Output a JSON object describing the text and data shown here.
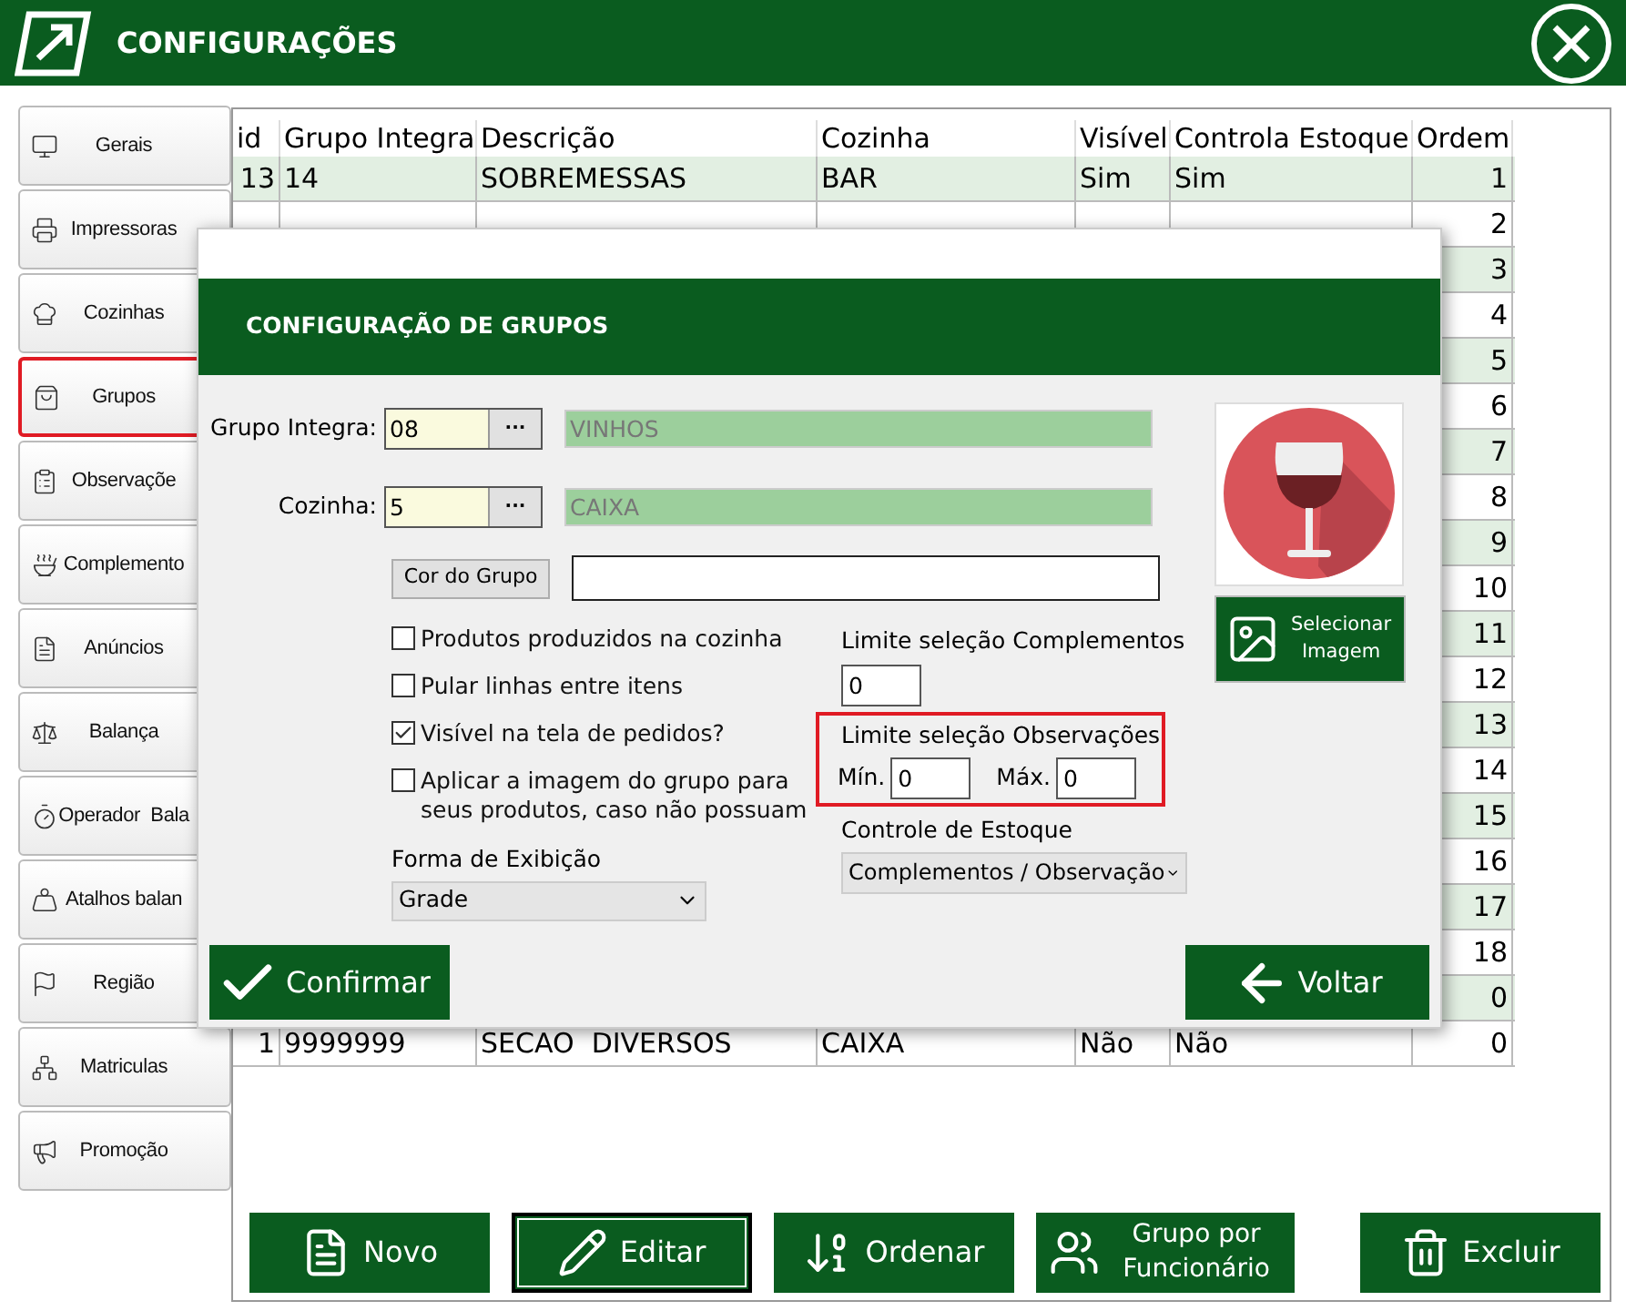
{
  "window": {
    "title": "CONFIGURAÇÕES"
  },
  "sidebar": {
    "items": [
      {
        "label": "Gerais",
        "selected": false
      },
      {
        "label": "Impressoras",
        "selected": false
      },
      {
        "label": "Cozinhas",
        "selected": false
      },
      {
        "label": "Grupos",
        "selected": true
      },
      {
        "label": "Observaçõe",
        "selected": false
      },
      {
        "label": "Complemento",
        "selected": false
      },
      {
        "label": "Anúncios",
        "selected": false
      },
      {
        "label": "Balança",
        "selected": false
      },
      {
        "label": "Operador  Bala",
        "selected": false
      },
      {
        "label": "Atalhos balan",
        "selected": false
      },
      {
        "label": "Região",
        "selected": false
      },
      {
        "label": "Matriculas",
        "selected": false
      },
      {
        "label": "Promoção",
        "selected": false
      }
    ]
  },
  "table": {
    "columns": [
      "id",
      "Grupo Integra",
      "Descrição",
      "Cozinha",
      "Visível",
      "Controla Estoque",
      "Ordem"
    ],
    "rows": [
      {
        "cells": [
          "13",
          "14",
          "SOBREMESSAS",
          "BAR",
          "Sim",
          "Sim",
          "1"
        ]
      },
      {
        "ordem": "2"
      },
      {
        "ordem": "3"
      },
      {
        "ordem": "4"
      },
      {
        "ordem": "5"
      },
      {
        "ordem": "6"
      },
      {
        "ordem": "7"
      },
      {
        "ordem": "8"
      },
      {
        "ordem": "9"
      },
      {
        "ordem": "10"
      },
      {
        "ordem": "11"
      },
      {
        "ordem": "12"
      },
      {
        "ordem": "13"
      },
      {
        "ordem": "14"
      },
      {
        "ordem": "15"
      },
      {
        "ordem": "16"
      },
      {
        "ordem": "17"
      },
      {
        "ordem": "18"
      },
      {
        "ordem": "0"
      },
      {
        "cells": [
          "1",
          "9999999",
          "SECAO  DIVERSOS",
          "CAIXA",
          "Não",
          "Não",
          "0"
        ]
      }
    ]
  },
  "toolbar": [
    {
      "label": "Novo",
      "selected": false
    },
    {
      "label": "Editar",
      "selected": true
    },
    {
      "label": "Ordenar",
      "selected": false
    },
    {
      "label": "Grupo por Funcionário",
      "selected": false
    },
    {
      "label": "Excluir",
      "selected": false
    }
  ],
  "dialog": {
    "title": "CONFIGURAÇÃO DE GRUPOS",
    "grupo_integra": {
      "label": "Grupo Integra:",
      "value": "08",
      "lookup_button": "···",
      "description": "VINHOS"
    },
    "cozinha": {
      "label": "Cozinha:",
      "value": "5",
      "lookup_button": "···",
      "description": "CAIXA"
    },
    "color_button": "Cor do Grupo",
    "checkboxes": [
      {
        "label": "Produtos produzidos na cozinha",
        "checked": false
      },
      {
        "label": "Pular linhas entre itens",
        "checked": false
      },
      {
        "label": "Visível na tela de pedidos?",
        "checked": true
      },
      {
        "label": "Aplicar a imagem do grupo para seus produtos, caso não possuam",
        "checked": false
      }
    ],
    "display_mode": {
      "label": "Forma de Exibição",
      "value": "Grade"
    },
    "limit_complementos": {
      "label": "Limite seleção Complementos",
      "value": "0"
    },
    "limit_observacoes": {
      "label": "Limite seleção Observações",
      "min_label": "Mín.",
      "min": "0",
      "max_label": "Máx.",
      "max": "0"
    },
    "stock_control": {
      "label": "Controle de Estoque",
      "value": "Complementos / Observação"
    },
    "select_image_button": "Selecionar Imagem",
    "confirm_button": "Confirmar",
    "back_button": "Voltar"
  }
}
